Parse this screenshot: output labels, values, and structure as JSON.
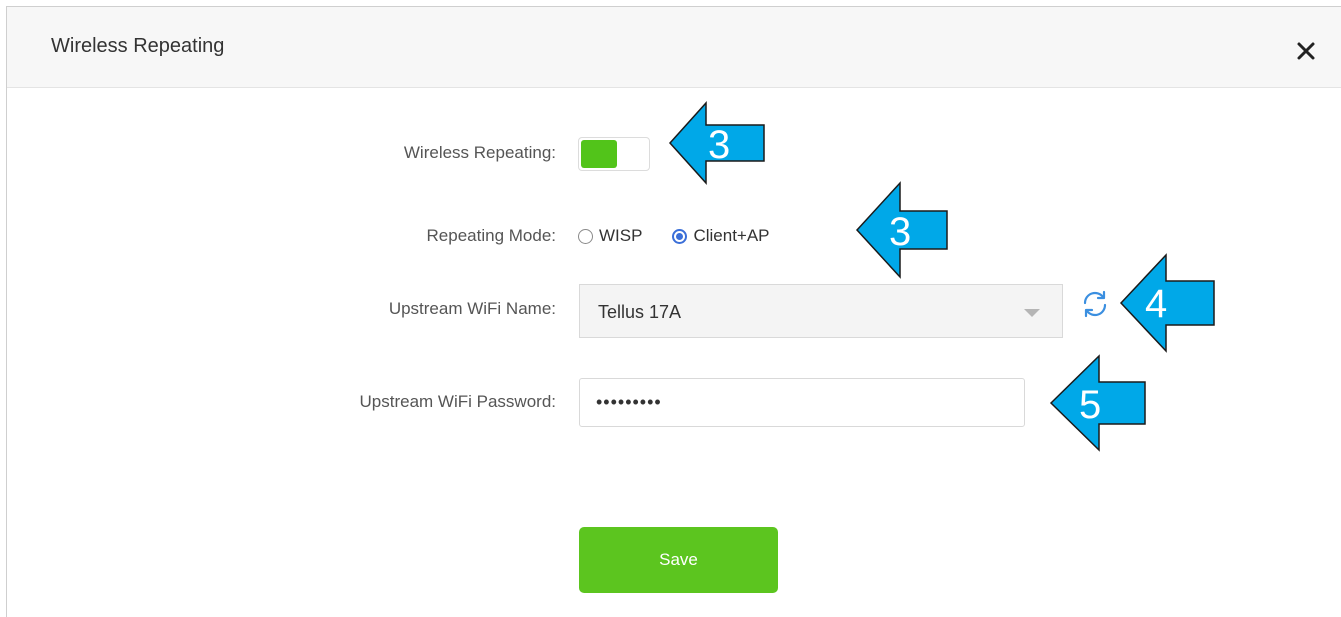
{
  "dialog": {
    "title": "Wireless Repeating",
    "close_icon": "close-icon"
  },
  "form": {
    "wireless_repeating": {
      "label": "Wireless Repeating:",
      "enabled": true,
      "on_color": "#52c41a"
    },
    "repeating_mode": {
      "label": "Repeating Mode:",
      "options": [
        "WISP",
        "Client+AP"
      ],
      "selected": "Client+AP",
      "radio_color": "#3b6fd8"
    },
    "upstream_wifi_name": {
      "label": "Upstream WiFi Name:",
      "value": "Tellus 17A",
      "refresh_icon": "refresh-icon"
    },
    "upstream_wifi_password": {
      "label": "Upstream WiFi Password:",
      "value": "•••••••••"
    },
    "save_label": "Save",
    "save_color": "#5cc51f"
  },
  "callouts": [
    {
      "number": "3",
      "target": "wireless-repeating-toggle"
    },
    {
      "number": "3",
      "target": "repeating-mode-client-ap"
    },
    {
      "number": "4",
      "target": "refresh-button"
    },
    {
      "number": "5",
      "target": "upstream-wifi-password-field"
    }
  ],
  "callout_color": "#00a8e8"
}
